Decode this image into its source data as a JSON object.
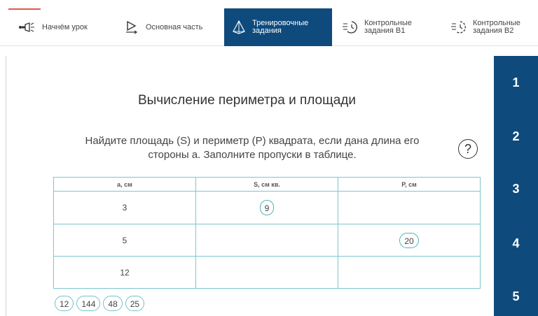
{
  "nav": {
    "tabs": [
      {
        "id": "start",
        "label": "Начнём урок",
        "icon": "flashlight-icon"
      },
      {
        "id": "main",
        "label": "Основная часть",
        "icon": "play-icon"
      },
      {
        "id": "train",
        "label_line1": "Тренировочные",
        "label_line2": "задания",
        "icon": "pyramid-icon",
        "active": true
      },
      {
        "id": "b1",
        "label_line1": "Контрольные",
        "label_line2": "задания В1",
        "icon": "timer-icon"
      },
      {
        "id": "b2",
        "label_line1": "Контрольные",
        "label_line2": "задания В2",
        "icon": "timer-icon"
      }
    ]
  },
  "sidebar": {
    "items": [
      "1",
      "2",
      "3",
      "4",
      "5"
    ]
  },
  "main": {
    "title": "Вычисление периметра и площади",
    "instruction_line1": "Найдите площадь (S) и периметр (P) квадрата, если дана длина его",
    "instruction_line2": "стороны a. Заполните пропуски в таблице.",
    "help_symbol": "?"
  },
  "table": {
    "headers": [
      "a, см",
      "S, см кв.",
      "P, см"
    ],
    "rows": [
      {
        "a": "3",
        "s": "9",
        "p": ""
      },
      {
        "a": "5",
        "s": "",
        "p": "20"
      },
      {
        "a": "12",
        "s": "",
        "p": ""
      }
    ]
  },
  "options": [
    "12",
    "144",
    "48",
    "25"
  ],
  "colors": {
    "accent": "#0e4a7c",
    "border": "#7cc7cf",
    "highlight": "#e05a47"
  }
}
